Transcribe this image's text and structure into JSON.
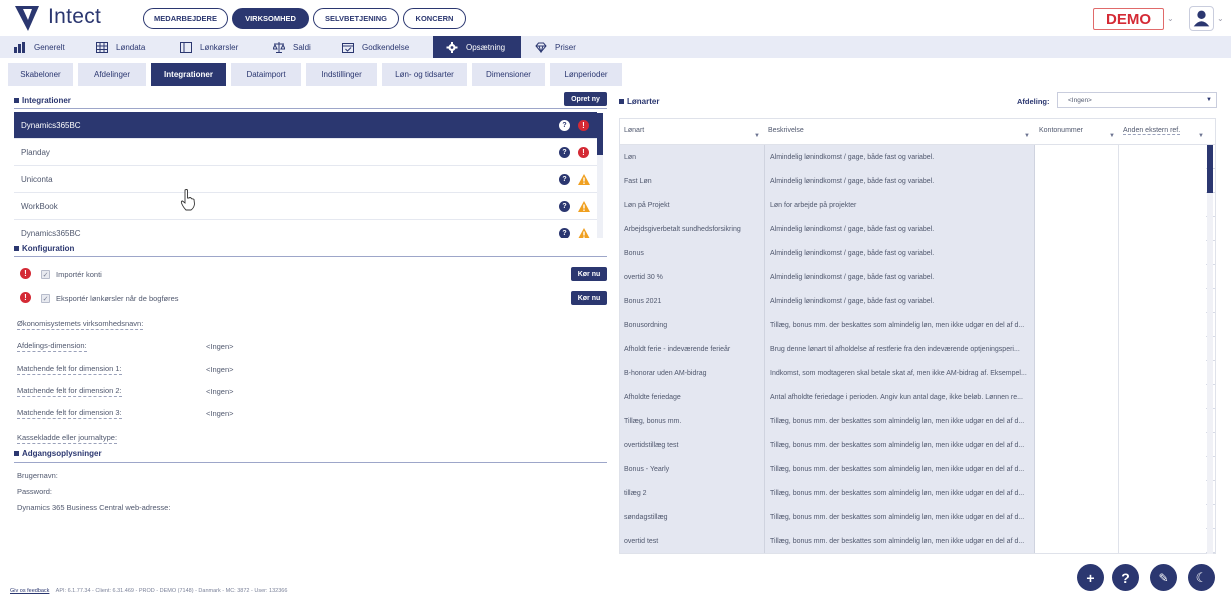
{
  "header": {
    "brand": "Intect",
    "nav_pills": [
      "MEDARBEJDERE",
      "VIRKSOMHED",
      "SELVBETJENING",
      "KONCERN"
    ],
    "active_pill": "VIRKSOMHED",
    "demo_label": "DEMO"
  },
  "main_nav": {
    "items": [
      {
        "label": "Generelt",
        "icon": "chart-icon"
      },
      {
        "label": "Løndata",
        "icon": "grid-icon"
      },
      {
        "label": "Lønkørsler",
        "icon": "screen-icon"
      },
      {
        "label": "Saldi",
        "icon": "scale-icon"
      },
      {
        "label": "Godkendelse",
        "icon": "calendar-check-icon"
      },
      {
        "label": "Opsætning",
        "icon": "gear-icon"
      },
      {
        "label": "Priser",
        "icon": "diamond-icon"
      }
    ],
    "active": "Opsætning"
  },
  "sub_tabs": {
    "items": [
      "Skabeloner",
      "Afdelinger",
      "Integrationer",
      "Dataimport",
      "Indstillinger",
      "Løn- og tidsarter",
      "Dimensioner",
      "Lønperioder"
    ],
    "active": "Integrationer"
  },
  "integrations": {
    "title": "Integrationer",
    "create_button": "Opret ny",
    "rows": [
      {
        "name": "Dynamics365BC",
        "status": "error"
      },
      {
        "name": "Planday",
        "status": "error"
      },
      {
        "name": "Uniconta",
        "status": "warning"
      },
      {
        "name": "WorkBook",
        "status": "warning"
      },
      {
        "name": "Dynamics365BC",
        "status": "warning"
      }
    ],
    "help_glyph": "?",
    "error_glyph": "!"
  },
  "configuration": {
    "title": "Konfiguration",
    "checkbox_rows": [
      {
        "label": "Importér konti",
        "button": "Kør nu"
      },
      {
        "label": "Eksportér lønkørsler når de bogføres",
        "button": "Kør nu"
      }
    ],
    "fields": [
      {
        "label": "Økonomisystemets virksomhedsnavn:",
        "value": ""
      },
      {
        "label": "Afdelings-dimension:",
        "value": "<Ingen>"
      },
      {
        "label": "Matchende felt for dimension 1:",
        "value": "<Ingen>"
      },
      {
        "label": "Matchende felt for dimension 2:",
        "value": "<Ingen>"
      },
      {
        "label": "Matchende felt for dimension 3:",
        "value": "<Ingen>"
      },
      {
        "label": "Kassekladde eller journaltype:",
        "value": ""
      }
    ]
  },
  "access": {
    "title": "Adgangsoplysninger",
    "fields": [
      "Brugernavn:",
      "Password:",
      "Dynamics 365 Business Central web-adresse:"
    ]
  },
  "salary_types": {
    "title": "Lønarter",
    "department_label": "Afdeling:",
    "department_value": "<Ingen>",
    "columns": [
      "Lønart",
      "Beskrivelse",
      "Kontonummer",
      "Anden ekstern ref."
    ],
    "rows": [
      {
        "type": "Løn",
        "desc": "Almindelig lønindkomst / gage, både fast og variabel."
      },
      {
        "type": "Fast Løn",
        "desc": "Almindelig lønindkomst / gage, både fast og variabel."
      },
      {
        "type": "Løn på Projekt",
        "desc": "Løn for arbejde på projekter"
      },
      {
        "type": "Arbejdsgiverbetalt sundhedsforsikring",
        "desc": "Almindelig lønindkomst / gage, både fast og variabel."
      },
      {
        "type": "Bonus",
        "desc": "Almindelig lønindkomst / gage, både fast og variabel."
      },
      {
        "type": "overtid 30 %",
        "desc": "Almindelig lønindkomst / gage, både fast og variabel."
      },
      {
        "type": "Bonus 2021",
        "desc": "Almindelig lønindkomst / gage, både fast og variabel."
      },
      {
        "type": "Bonusordning",
        "desc": "Tillæg, bonus mm. der beskattes som almindelig løn, men ikke udgør en del af d..."
      },
      {
        "type": "Afholdt ferie - indeværende ferieår",
        "desc": "Brug denne lønart til afholdelse af restferie fra den indeværende optjeningsperi..."
      },
      {
        "type": "B-honorar uden AM-bidrag",
        "desc": "Indkomst, som modtageren skal betale skat af, men ikke AM-bidrag af. Eksempel..."
      },
      {
        "type": "Afholdte feriedage",
        "desc": "Antal afholdte feriedage i perioden. Angiv kun antal dage, ikke beløb. Lønnen re..."
      },
      {
        "type": "Tillæg, bonus mm.",
        "desc": "Tillæg, bonus mm. der beskattes som almindelig løn, men ikke udgør en del af d..."
      },
      {
        "type": "overtidstillæg test",
        "desc": "Tillæg, bonus mm. der beskattes som almindelig løn, men ikke udgør en del af d..."
      },
      {
        "type": "Bonus - Yearly",
        "desc": "Tillæg, bonus mm. der beskattes som almindelig løn, men ikke udgør en del af d..."
      },
      {
        "type": "tillæg 2",
        "desc": "Tillæg, bonus mm. der beskattes som almindelig løn, men ikke udgør en del af d..."
      },
      {
        "type": "søndagstillæg",
        "desc": "Tillæg, bonus mm. der beskattes som almindelig løn, men ikke udgør en del af d..."
      },
      {
        "type": "overtid test",
        "desc": "Tillæg, bonus mm. der beskattes som almindelig løn, men ikke udgør en del af d..."
      }
    ]
  },
  "fabs": [
    "+",
    "?",
    "✎",
    "☾"
  ],
  "footer": {
    "feedback": "Giv os feedback",
    "info": "API: 6.1.77.34 - Client: 6.31.469 - PROD - DEMO (7148) - Danmark - MC: 3872 - User: 132366"
  },
  "colors": {
    "primary": "#2b3770",
    "error": "#d42a35",
    "warning": "#f0a020",
    "nav_bg": "#e8ebf6"
  }
}
